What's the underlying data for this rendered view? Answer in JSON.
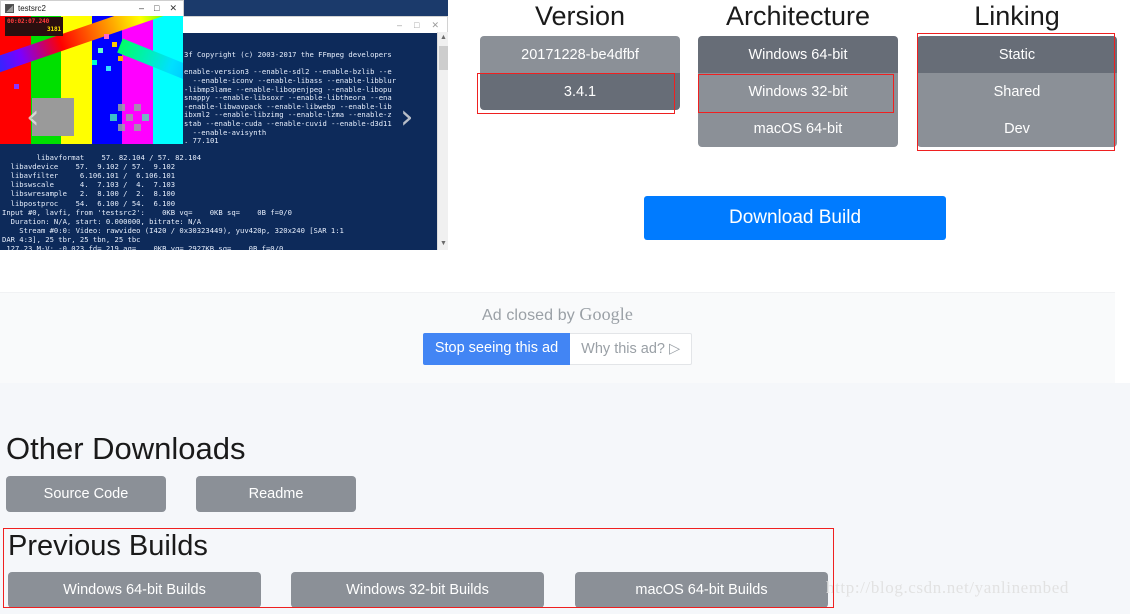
{
  "adImage": {
    "window": {
      "title": "testsrc2",
      "minimize": "–",
      "maximize": "□",
      "close": "✕"
    },
    "overlay": {
      "timestamp": "00:02:07.240",
      "frame": "3181"
    },
    "console_top": "3f Copyright (c) 2003-2017 the FFmpeg developers\n\nenable-version3 --enable-sdl2 --enable-bzlib --e\n  --enable-iconv --enable-libass --enable-libblur\n-libmp3lame --enable-libopenjpeg --enable-libopu\nsnappy --enable-libsoxr --enable-libtheora --ena\n-enable-libwavpack --enable-libwebp --enable-lib\nibxml2 --enable-libzimg --enable-lzma --enable-z\nstab --enable-cuda --enable-cuvid --enable-d3d11\n  --enable-avisynth\n. 77.101\n.106.104",
    "console_lower": "  libavformat    57. 82.104 / 57. 82.104\n  libavdevice    57.  9.102 / 57.  9.102\n  libavfilter     6.106.101 /  6.106.101\n  libswscale      4.  7.103 /  4.  7.103\n  libswresample   2.  8.100 /  2.  8.100\n  libpostproc    54.  6.100 / 54.  6.100\nInput #0, lavfi, from 'testsrc2':    0KB vq=    0KB sq=    0B f=0/0\n  Duration: N/A, start: 0.000000, bitrate: N/A\n    Stream #0:0: Video: rawvideo (I420 / 0x30323449), yuv420p, 320x240 [SAR 1:1\nDAR 4:3], 25 tbr, 25 tbn, 25 tbc\n 127.23 M-V: -0.023 fd= 219 aq=    0KB vq= 2927KB sq=    0B f=0/0",
    "nav_prev": "‹",
    "nav_next": "›",
    "scroll_up": "▲",
    "scroll_down": "▼"
  },
  "selectors": {
    "columns": [
      {
        "title": "Version",
        "name": "version",
        "options": [
          {
            "label": "20171228-be4dfbf",
            "selected": false
          },
          {
            "label": "3.4.1",
            "selected": true
          }
        ]
      },
      {
        "title": "Architecture",
        "name": "architecture",
        "options": [
          {
            "label": "Windows 64-bit",
            "selected": true
          },
          {
            "label": "Windows 32-bit",
            "selected": false
          },
          {
            "label": "macOS 64-bit",
            "selected": false
          }
        ]
      },
      {
        "title": "Linking",
        "name": "linking",
        "options": [
          {
            "label": "Static",
            "selected": true
          },
          {
            "label": "Shared",
            "selected": false
          },
          {
            "label": "Dev",
            "selected": false
          }
        ]
      }
    ],
    "download_button": "Download Build",
    "accent_color": "#007bff",
    "option_color": "#8b9097",
    "option_selected_color": "#676d77",
    "annotation_color": "#ef2020"
  },
  "ad": {
    "closed_text": "Ad closed by",
    "brand": "Google",
    "stop_button": "Stop seeing this ad",
    "why_button": "Why this ad? ▷",
    "stop_color": "#4285f4"
  },
  "other_downloads": {
    "heading": "Other Downloads",
    "buttons": [
      {
        "label": "Source Code"
      },
      {
        "label": "Readme"
      }
    ]
  },
  "previous_builds": {
    "heading": "Previous Builds",
    "buttons": [
      {
        "label": "Windows 64-bit Builds"
      },
      {
        "label": "Windows 32-bit Builds"
      },
      {
        "label": "macOS 64-bit Builds"
      }
    ]
  },
  "watermark": "http://blog.csdn.net/yanlinembed"
}
